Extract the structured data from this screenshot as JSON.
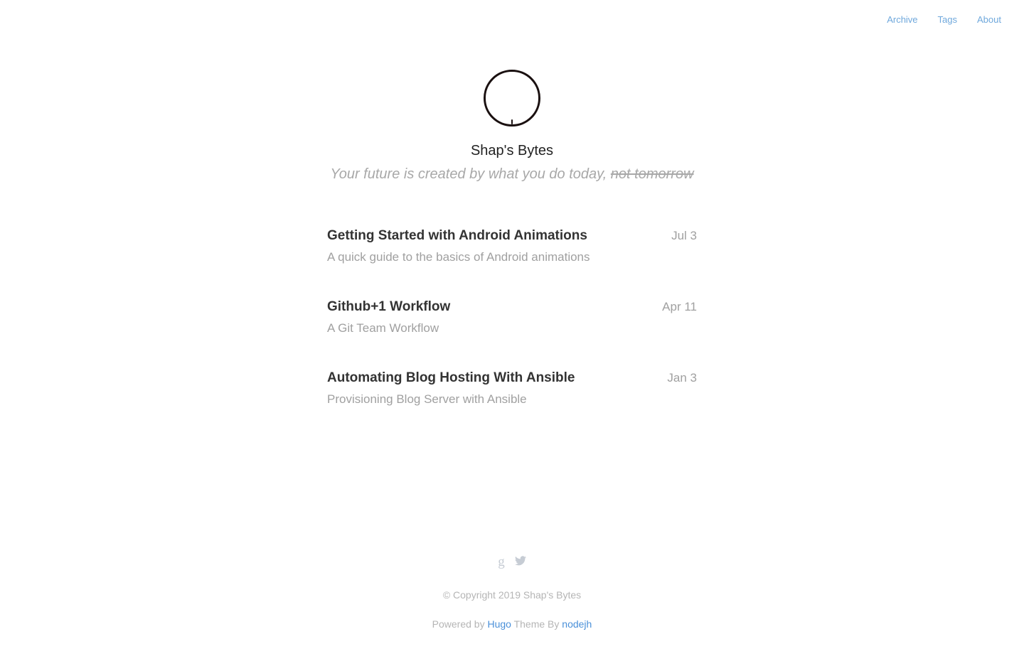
{
  "nav": {
    "archive": "Archive",
    "tags": "Tags",
    "about": "About"
  },
  "header": {
    "title": "Shap's Bytes",
    "tagline_main": "Your future is created by what you do today, ",
    "tagline_struck": "not tomorrow"
  },
  "posts": [
    {
      "title": "Getting Started with Android Animations",
      "date": "Jul 3",
      "summary": "A quick guide to the basics of Android animations"
    },
    {
      "title": "Github+1 Workflow",
      "date": "Apr 11",
      "summary": "A Git Team Workflow"
    },
    {
      "title": "Automating Blog Hosting With Ansible",
      "date": "Jan 3",
      "summary": "Provisioning Blog Server with Ansible"
    }
  ],
  "footer": {
    "social_icons": [
      "google-plus-icon",
      "twitter-icon"
    ],
    "google_glyph": "g",
    "copyright": "© Copyright 2019 Shap's Bytes",
    "powered_prefix": "Powered by ",
    "hugo_link": "Hugo",
    "theme_by": " Theme By ",
    "theme_author_link": "nodejh"
  },
  "colors": {
    "nav_link": "#6fa8dc",
    "footer_link": "#4a90d9",
    "muted_text": "#a0a0a0",
    "title_text": "#333333"
  }
}
